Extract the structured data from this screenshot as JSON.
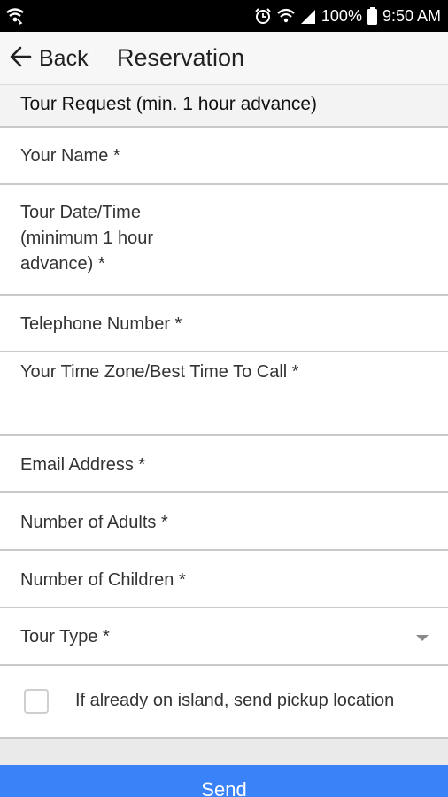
{
  "status_bar": {
    "battery_percent": "100%",
    "time": "9:50 AM",
    "icons": [
      "wifi-calling-icon",
      "alarm-icon",
      "wifi-icon",
      "signal-icon",
      "battery-icon"
    ]
  },
  "app_bar": {
    "back_label": "Back",
    "title": "Reservation"
  },
  "section_header": "Tour Request (min. 1 hour advance)",
  "fields": {
    "name": "Your Name *",
    "tour_date_line1": "Tour Date/Time",
    "tour_date_line2": "(minimum 1 hour",
    "tour_date_line3": "advance) *",
    "telephone": "Telephone Number *",
    "time_zone": "Your Time Zone/Best Time To Call *",
    "email": "Email Address *",
    "adults": "Number of Adults *",
    "children": "Number of Children *",
    "tour_type": "Tour Type *"
  },
  "checkbox": {
    "label": "If already on island, send pickup location",
    "checked": false
  },
  "send_label": "Send",
  "colors": {
    "primary": "#3a82f7",
    "status_bar": "#000000",
    "divider": "#c9c9c9"
  }
}
